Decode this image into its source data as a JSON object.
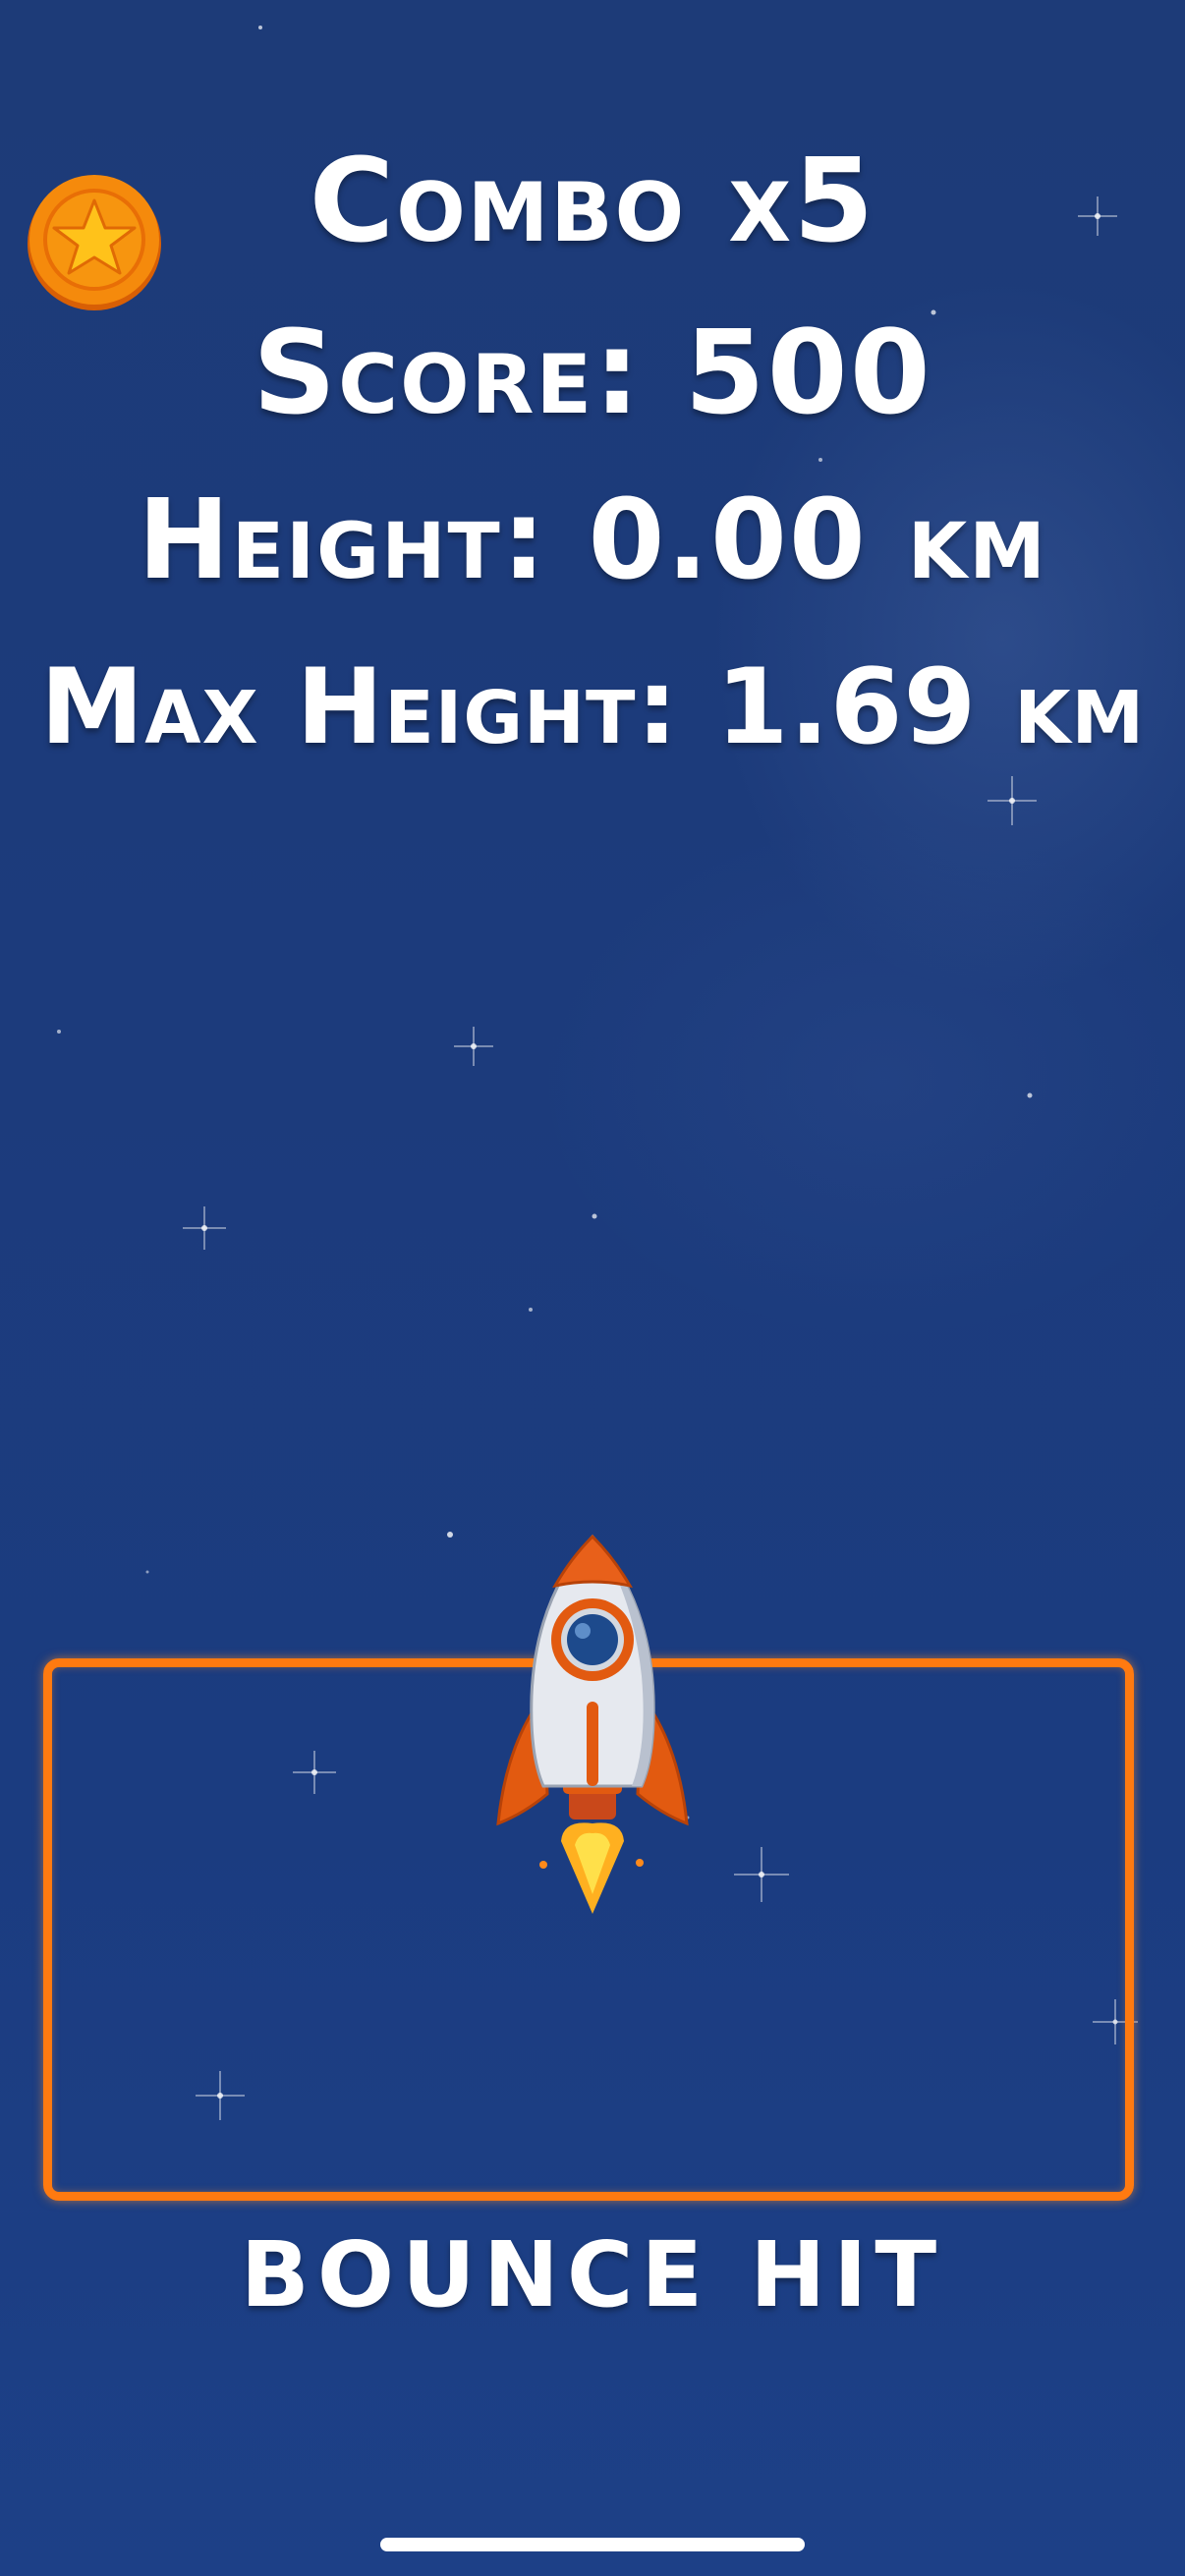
{
  "hud": {
    "combo": "Combo x5",
    "score": "Score: 500",
    "height": "Height: 0.00 km",
    "max_height": "Max Height: 1.69 km"
  },
  "zone": {
    "label": "BOUNCE HIT"
  },
  "icons": {
    "coin": "star-coin-icon",
    "player": "rocket-icon"
  },
  "colors": {
    "background": "#1c3b7c",
    "zone_border": "#ff7a10",
    "text": "#ffffff",
    "coin": "#f58a0c"
  }
}
